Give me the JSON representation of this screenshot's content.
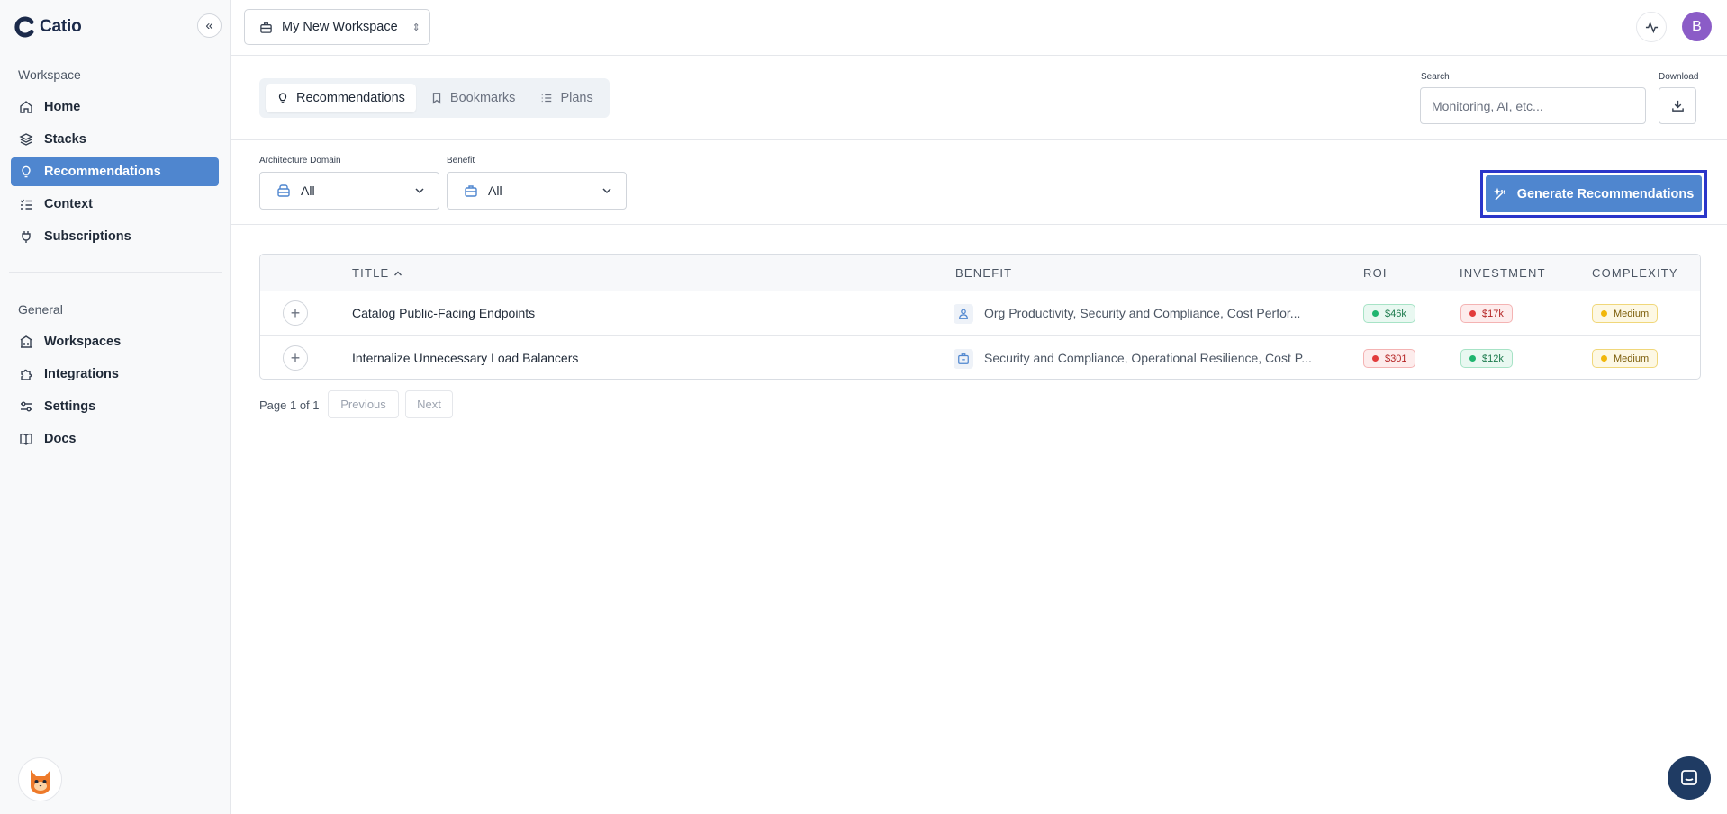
{
  "app": {
    "name": "Catio"
  },
  "sidebar": {
    "workspace_label": "Workspace",
    "workspace_items": [
      {
        "label": "Home",
        "icon": "home-icon"
      },
      {
        "label": "Stacks",
        "icon": "layers-icon"
      },
      {
        "label": "Recommendations",
        "icon": "lightbulb-icon",
        "active": true
      },
      {
        "label": "Context",
        "icon": "list-check-icon"
      },
      {
        "label": "Subscriptions",
        "icon": "plug-icon"
      }
    ],
    "general_label": "General",
    "general_items": [
      {
        "label": "Workspaces",
        "icon": "building-icon"
      },
      {
        "label": "Integrations",
        "icon": "puzzle-icon"
      },
      {
        "label": "Settings",
        "icon": "sliders-icon"
      },
      {
        "label": "Docs",
        "icon": "book-icon"
      }
    ]
  },
  "header": {
    "workspace_name": "My New Workspace",
    "avatar_initial": "B"
  },
  "tabs": [
    {
      "label": "Recommendations",
      "active": true
    },
    {
      "label": "Bookmarks"
    },
    {
      "label": "Plans"
    }
  ],
  "search": {
    "label": "Search",
    "placeholder": "Monitoring, AI, etc..."
  },
  "download": {
    "label": "Download"
  },
  "filters": {
    "architecture_domain": {
      "label": "Architecture Domain",
      "value": "All"
    },
    "benefit": {
      "label": "Benefit",
      "value": "All"
    }
  },
  "generate_button": {
    "label": "Generate Recommendations"
  },
  "table": {
    "columns": {
      "title": "TITLE",
      "benefit": "BENEFIT",
      "roi": "ROI",
      "investment": "INVESTMENT",
      "complexity": "COMPLEXITY"
    },
    "rows": [
      {
        "title": "Catalog Public-Facing Endpoints",
        "benefit": "Org Productivity, Security and Compliance, Cost Perfor...",
        "roi": "$46k",
        "roi_status": "green",
        "investment": "$17k",
        "investment_status": "red",
        "complexity": "Medium"
      },
      {
        "title": "Internalize Unnecessary Load Balancers",
        "benefit": "Security and Compliance, Operational Resilience, Cost P...",
        "roi": "$301",
        "roi_status": "red",
        "investment": "$12k",
        "investment_status": "green",
        "complexity": "Medium"
      }
    ]
  },
  "pagination": {
    "info": "Page 1 of 1",
    "previous": "Previous",
    "next": "Next"
  },
  "colors": {
    "accent": "#4f86cf",
    "focus_outline": "#2b36c9",
    "avatar": "#8b5cc7"
  }
}
